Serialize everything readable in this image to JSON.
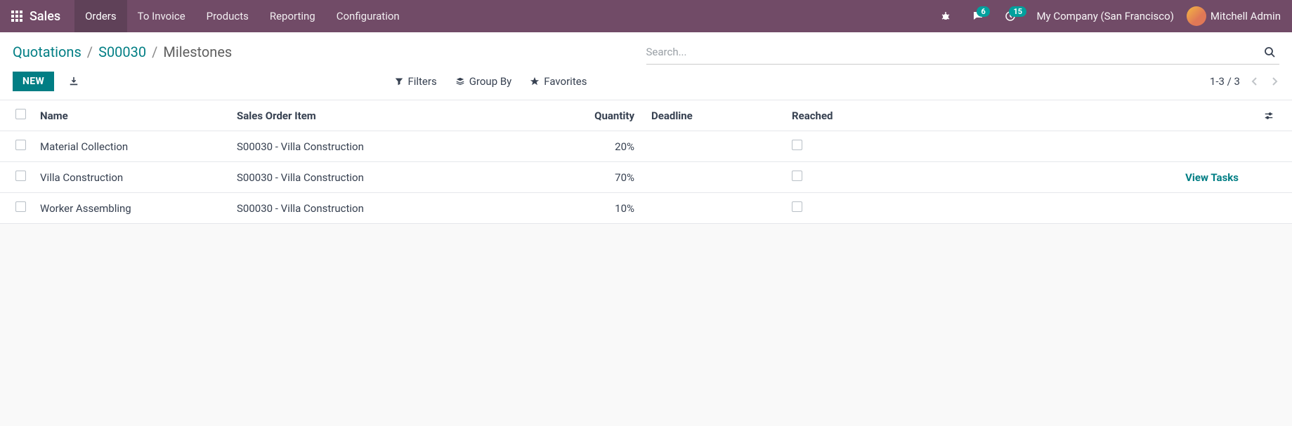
{
  "navbar": {
    "brand": "Sales",
    "items": [
      "Orders",
      "To Invoice",
      "Products",
      "Reporting",
      "Configuration"
    ],
    "active_index": 0,
    "chat_badge": "6",
    "activity_badge": "15",
    "company": "My Company (San Francisco)",
    "user_name": "Mitchell Admin"
  },
  "breadcrumb": {
    "root": "Quotations",
    "ref": "S00030",
    "current": "Milestones"
  },
  "search": {
    "placeholder": "Search..."
  },
  "buttons": {
    "new": "NEW",
    "filters": "Filters",
    "group_by": "Group By",
    "favorites": "Favorites"
  },
  "pager": {
    "text": "1-3 / 3"
  },
  "table": {
    "headers": {
      "name": "Name",
      "sales_order_item": "Sales Order Item",
      "quantity": "Quantity",
      "deadline": "Deadline",
      "reached": "Reached"
    },
    "rows": [
      {
        "name": "Material Collection",
        "sales_order_item": "S00030 - Villa Construction",
        "quantity": "20%",
        "deadline": "",
        "reached": false,
        "action": ""
      },
      {
        "name": "Villa Construction",
        "sales_order_item": "S00030 - Villa Construction",
        "quantity": "70%",
        "deadline": "",
        "reached": false,
        "action": "View Tasks"
      },
      {
        "name": "Worker Assembling",
        "sales_order_item": "S00030 - Villa Construction",
        "quantity": "10%",
        "deadline": "",
        "reached": false,
        "action": ""
      }
    ]
  }
}
